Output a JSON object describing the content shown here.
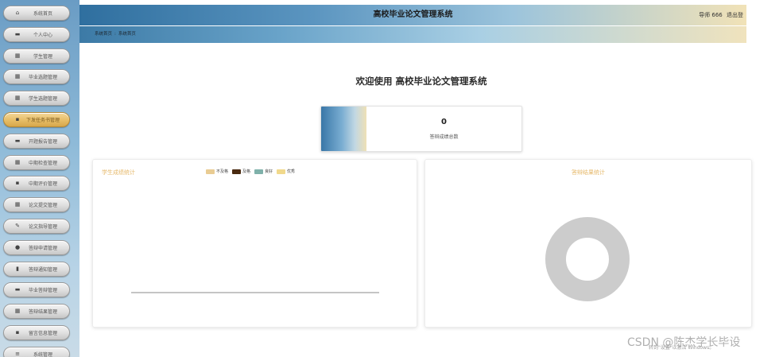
{
  "sidebar": {
    "items": [
      {
        "label": "系统首页",
        "icon": "home-icon",
        "glyph": "⌂",
        "active": false
      },
      {
        "label": "个人中心",
        "icon": "user-icon",
        "glyph": "▬",
        "active": false
      },
      {
        "label": "学生管理",
        "icon": "grid-icon",
        "glyph": "▦",
        "active": false
      },
      {
        "label": "毕业选题管理",
        "icon": "grid-icon",
        "glyph": "▦",
        "active": false
      },
      {
        "label": "学生选题管理",
        "icon": "grid-icon",
        "glyph": "▦",
        "active": false
      },
      {
        "label": "下发任务书管理",
        "icon": "document-icon",
        "glyph": "▪",
        "active": true
      },
      {
        "label": "开题报告管理",
        "icon": "card-icon",
        "glyph": "▬",
        "active": false
      },
      {
        "label": "中期检查管理",
        "icon": "grid-icon",
        "glyph": "▦",
        "active": false
      },
      {
        "label": "中期评价管理",
        "icon": "document-icon",
        "glyph": "▪",
        "active": false
      },
      {
        "label": "论文提交管理",
        "icon": "grid-icon",
        "glyph": "▦",
        "active": false
      },
      {
        "label": "论文指导管理",
        "icon": "edit-icon",
        "glyph": "✎",
        "active": false
      },
      {
        "label": "答辩申请管理",
        "icon": "location-icon",
        "glyph": "●",
        "active": false
      },
      {
        "label": "答辩通知管理",
        "icon": "bar-chart-icon",
        "glyph": "▮",
        "active": false
      },
      {
        "label": "毕业答辩管理",
        "icon": "briefcase-icon",
        "glyph": "▬",
        "active": false
      },
      {
        "label": "答辩结果管理",
        "icon": "grid-icon",
        "glyph": "▦",
        "active": false
      },
      {
        "label": "留言信息管理",
        "icon": "document-icon",
        "glyph": "▪",
        "active": false
      },
      {
        "label": "系统管理",
        "icon": "menu-icon",
        "glyph": "≡",
        "active": false
      }
    ]
  },
  "header": {
    "title": "高校毕业论文管理系统",
    "user_text": "导师 666",
    "logout_label": "退出登"
  },
  "breadcrumb": {
    "items": [
      "系统首页",
      "系统首页"
    ],
    "separator": ":"
  },
  "welcome": "欢迎使用 高校毕业论文管理系统",
  "stat_card": {
    "value": "0",
    "label": "答辩成绩总数"
  },
  "panels": {
    "left_title": "学生成绩统计",
    "right_title": "答辩结果统计"
  },
  "colors": {
    "title_accent": "#e6b96b",
    "donut": "#cccccc"
  },
  "chart_data": [
    {
      "type": "bar",
      "title": "学生成绩统计",
      "legend": [
        {
          "name": "不及格",
          "color": "#e9cc93"
        },
        {
          "name": "及格",
          "color": "#4a2a10"
        },
        {
          "name": "良好",
          "color": "#7fb1aa"
        },
        {
          "name": "优秀",
          "color": "#f1d98c"
        }
      ],
      "categories": [],
      "series": [],
      "legend_position": "top-center"
    },
    {
      "type": "pie",
      "title": "答辩结果统计",
      "slices": [],
      "donut": true
    }
  ],
  "watermark": {
    "windows_text": "转到\"设置\"以激活 Windows。",
    "csdn_text": "CSDN @陈杰学长毕设"
  }
}
